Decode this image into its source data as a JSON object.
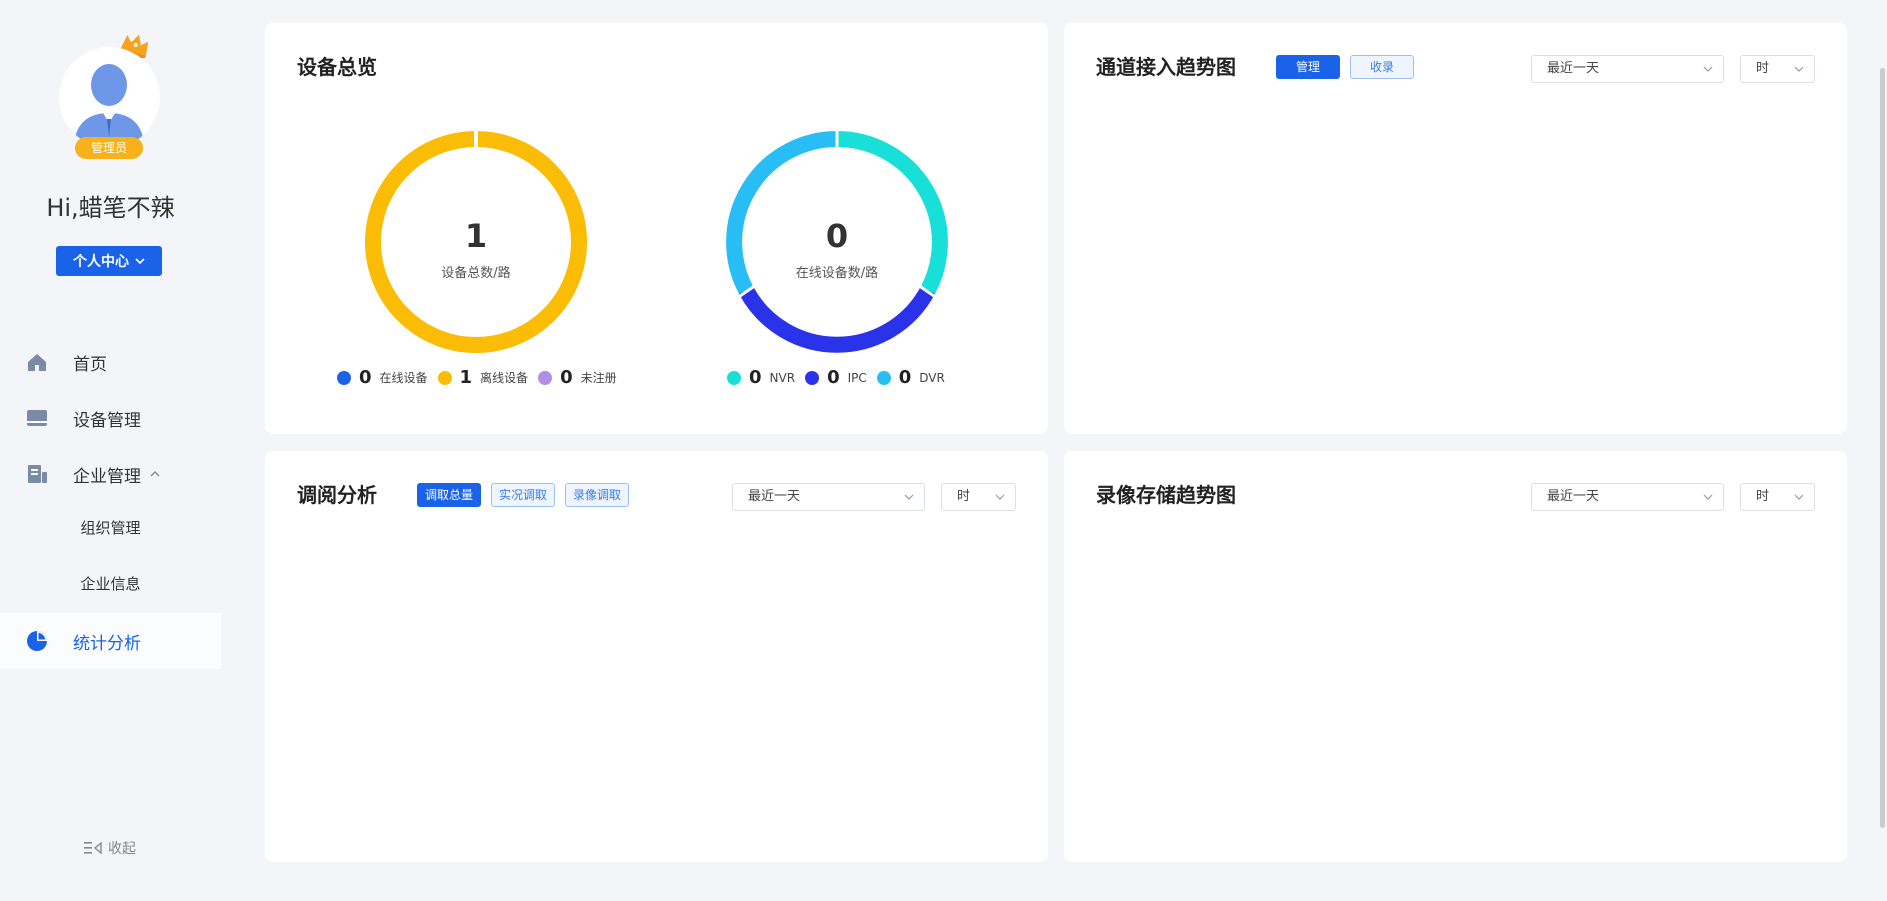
{
  "sidebar": {
    "role_badge": "管理员",
    "greeting": "Hi,蜡笔不辣",
    "center_button": "个人中心",
    "nav": [
      {
        "label": "首页",
        "icon": "home-icon"
      },
      {
        "label": "设备管理",
        "icon": "device-icon"
      },
      {
        "label": "企业管理",
        "icon": "enterprise-icon"
      },
      {
        "label": "统计分析",
        "icon": "pie-chart-icon"
      }
    ],
    "sub_items": [
      "组织管理",
      "企业信息"
    ],
    "collapse_label": "收起"
  },
  "device_overview": {
    "title": "设备总览",
    "total": {
      "value": "1",
      "label": "设备总数/路"
    },
    "online": {
      "value": "0",
      "label": "在线设备数/路"
    },
    "status_legend": [
      {
        "value": "0",
        "label": "在线设备",
        "color": "#1a63e8"
      },
      {
        "value": "1",
        "label": "离线设备",
        "color": "#fbbc05"
      },
      {
        "value": "0",
        "label": "未注册",
        "color": "#b18ee6"
      }
    ],
    "type_legend": [
      {
        "value": "0",
        "label": "NVR",
        "color": "#18e0d8"
      },
      {
        "value": "0",
        "label": "IPC",
        "color": "#2a33ea"
      },
      {
        "value": "0",
        "label": "DVR",
        "color": "#28bdf5"
      }
    ]
  },
  "channel_trend": {
    "title": "通道接入趋势图",
    "tabs": [
      "管理",
      "收录"
    ],
    "range": "最近一天",
    "unit": "时"
  },
  "review_analysis": {
    "title": "调阅分析",
    "tabs": [
      "调取总量",
      "实况调取",
      "录像调取"
    ],
    "range": "最近一天",
    "unit": "时"
  },
  "storage_trend": {
    "title": "录像存储趋势图",
    "range": "最近一天",
    "unit": "时"
  },
  "colors": {
    "accent": "#1a63e8",
    "yellow": "#fbbc05",
    "cyan": "#18e0d8",
    "blue": "#2a33ea",
    "sky": "#28bdf5"
  }
}
